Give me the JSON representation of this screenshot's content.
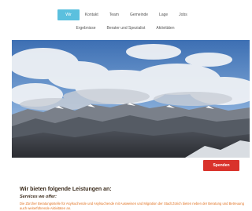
{
  "nav": {
    "row1": [
      "Wir",
      "Kontakt",
      "Team",
      "Gemeinde",
      "Lage",
      "Jobs"
    ],
    "row2": [
      "Ergebnisse",
      "Berater und Spezialist",
      "Aktivitäten"
    ],
    "active_index": 0
  },
  "hero": {
    "alt": "mountain-landscape-image"
  },
  "donate": {
    "label": "Spenden"
  },
  "services": {
    "title": "Wir bieten folgende Leistungen an:",
    "subtitle": "Services we offer:",
    "body": "Die Zürcher Beratungsstelle für Asylsuchende und Asylsuchende mit Ausweisen und Migration der Stadt Zürich bieten neben der Beratung und Betreuung auch weiterführende Aktivitäten an."
  },
  "colors": {
    "nav_active": "#5bc0de",
    "donate_button": "#d9322b",
    "body_text": "#e0701f"
  }
}
